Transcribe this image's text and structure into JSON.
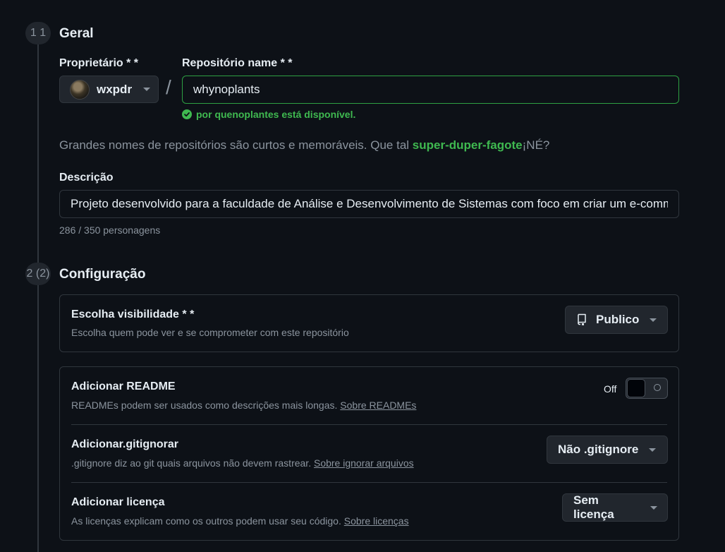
{
  "steps": [
    {
      "number": "1 1",
      "title": "Geral"
    },
    {
      "number": "2 (2)",
      "title": "Configuração"
    }
  ],
  "general": {
    "owner_label": "Proprietário * *",
    "owner_name": "wxpdr",
    "slash": "/",
    "repo_label": "Repositório name * *",
    "repo_value": "whynoplants",
    "availability": "por quenoplantes está disponível.",
    "hint_prefix": "Grandes nomes de repositórios são curtos e memoráveis. Que tal ",
    "hint_suggestion": "super-duper-fagote",
    "hint_suffix": "¡NÉ?",
    "description_label": "Descrição",
    "description_value": "Projeto desenvolvido para a faculdade de Análise e Desenvolvimento de Sistemas com foco em criar um e-commerce",
    "char_counter": "286 / 350 personagens"
  },
  "config": {
    "visibility": {
      "title": "Escolha visibilidade * *",
      "desc": "Escolha quem pode ver e se comprometer com este repositório",
      "selected": "Publico",
      "icon": "repo-icon"
    },
    "readme": {
      "title": "Adicionar README",
      "desc": "READMEs podem ser usados como descrições mais longas. ",
      "link": "Sobre READMEs",
      "toggle_label": "Off",
      "toggle_state": "off"
    },
    "gitignore": {
      "title": "Adicionar.gitignorar",
      "desc": ".gitignore diz ao git quais arquivos não devem rastrear. ",
      "link": "Sobre ignorar arquivos",
      "selected": "Não .gitignore"
    },
    "license": {
      "title": "Adicionar licença",
      "desc": "As licenças explicam como os outros podem usar seu código. ",
      "link": "Sobre licenças",
      "selected": "Sem licença"
    }
  },
  "colors": {
    "background": "#0d1117",
    "border": "#30363d",
    "success": "#3fb950",
    "muted": "#8b949e"
  }
}
